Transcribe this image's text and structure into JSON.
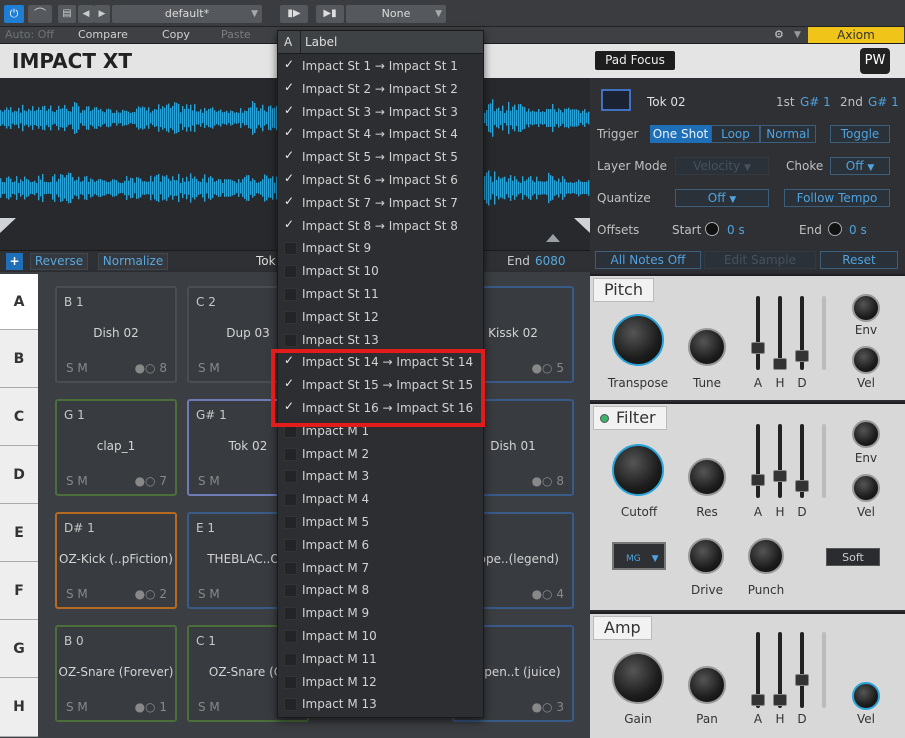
{
  "toolbar": {
    "preset": "default*",
    "routing": "None",
    "auto": "Auto: Off",
    "compare": "Compare",
    "copy": "Copy",
    "paste": "Paste",
    "device": "Axiom"
  },
  "header": {
    "logo": "IMPACT XT",
    "pad_focus": "Pad Focus"
  },
  "sample": {
    "reverse": "Reverse",
    "normalize": "Normalize",
    "name_partial": "Tok",
    "end_label": "End",
    "end_value": "6080"
  },
  "rows": [
    "A",
    "B",
    "C",
    "D",
    "E",
    "F",
    "G",
    "H"
  ],
  "pads": [
    {
      "note": "B 1",
      "name": "Dish 02",
      "count": "8",
      "color": "#4a4e54"
    },
    {
      "note": "C 2",
      "name": "Dup 03",
      "count": "",
      "color": "#4a4e54"
    },
    {
      "note": "",
      "name": "Kissk 02",
      "count": "5",
      "color": "#3a5a88"
    },
    {
      "note": "G 1",
      "name": "clap_1",
      "count": "7",
      "color": "#4b6e3b"
    },
    {
      "note": "G# 1",
      "name": "Tok 02",
      "count": "",
      "color": "#6e7bb6"
    },
    {
      "note": "",
      "name": "Dish 01",
      "count": "8",
      "color": "#3a5a88"
    },
    {
      "note": "D# 1",
      "name": "OZ-Kick (..pFiction)",
      "count": "2",
      "color": "#b76b22"
    },
    {
      "note": "E 1",
      "name": "THEBLAC..ON",
      "count": "",
      "color": "#3a5a88"
    },
    {
      "note": "",
      "name": "k-ope..(legend)",
      "count": "4",
      "color": "#3a5a88"
    },
    {
      "note": "B 0",
      "name": "OZ-Snare (Forever)",
      "count": "1",
      "color": "#4b6e3b"
    },
    {
      "note": "C 1",
      "name": "OZ-Snare (Cr",
      "count": "",
      "color": "#4b6e3b"
    },
    {
      "note": "",
      "name": "k-open..t (juice)",
      "count": "3",
      "color": "#3a5a88"
    }
  ],
  "pad_sm": "S  M",
  "right": {
    "pad_name": "Tok 02",
    "first": "1st",
    "first_val": "G# 1",
    "second": "2nd",
    "second_val": "G# 1",
    "trigger": "Trigger",
    "one_shot": "One Shot",
    "loop": "Loop",
    "normal": "Normal",
    "toggle": "Toggle",
    "layer_mode": "Layer Mode",
    "velocity": "Velocity",
    "choke": "Choke",
    "choke_val": "Off",
    "quantize": "Quantize",
    "quantize_val": "Off",
    "follow_tempo": "Follow Tempo",
    "offsets": "Offsets",
    "start": "Start",
    "start_val": "0 s",
    "end": "End",
    "end_val": "0 s",
    "all_notes_off": "All Notes Off",
    "edit_sample": "Edit Sample",
    "reset": "Reset"
  },
  "pitch": {
    "title": "Pitch",
    "transpose": "Transpose",
    "tune": "Tune",
    "a": "A",
    "h": "H",
    "d": "D",
    "env": "Env",
    "vel": "Vel"
  },
  "filter": {
    "title": "Filter",
    "cutoff": "Cutoff",
    "res": "Res",
    "a": "A",
    "h": "H",
    "d": "D",
    "env": "Env",
    "vel": "Vel",
    "drive": "Drive",
    "punch": "Punch",
    "soft": "Soft",
    "mode": "MG"
  },
  "amp": {
    "title": "Amp",
    "gain": "Gain",
    "pan": "Pan",
    "a": "A",
    "h": "H",
    "d": "D",
    "vel": "Vel"
  },
  "dropdown": {
    "col_a": "A",
    "col_label": "Label",
    "items": [
      {
        "label": "Impact St 1 → Impact St 1",
        "checked": true
      },
      {
        "label": "Impact St 2 → Impact St 2",
        "checked": true
      },
      {
        "label": "Impact St 3 → Impact St 3",
        "checked": true
      },
      {
        "label": "Impact St 4 → Impact St 4",
        "checked": true
      },
      {
        "label": "Impact St 5 → Impact St 5",
        "checked": true
      },
      {
        "label": "Impact St 6 → Impact St 6",
        "checked": true
      },
      {
        "label": "Impact St 7 → Impact St 7",
        "checked": true
      },
      {
        "label": "Impact St 8 → Impact St 8",
        "checked": true
      },
      {
        "label": "Impact St 9",
        "checked": false
      },
      {
        "label": "Impact St 10",
        "checked": false
      },
      {
        "label": "Impact St 11",
        "checked": false
      },
      {
        "label": "Impact St 12",
        "checked": false
      },
      {
        "label": "Impact St 13",
        "checked": false
      },
      {
        "label": "Impact St 14 → Impact St 14",
        "checked": true
      },
      {
        "label": "Impact St 15 → Impact St 15",
        "checked": true
      },
      {
        "label": "Impact St 16 → Impact St 16",
        "checked": true
      },
      {
        "label": "Impact M 1",
        "checked": false
      },
      {
        "label": "Impact M 2",
        "checked": false
      },
      {
        "label": "Impact M 3",
        "checked": false
      },
      {
        "label": "Impact M 4",
        "checked": false
      },
      {
        "label": "Impact M 5",
        "checked": false
      },
      {
        "label": "Impact M 6",
        "checked": false
      },
      {
        "label": "Impact M 7",
        "checked": false
      },
      {
        "label": "Impact M 8",
        "checked": false
      },
      {
        "label": "Impact M 9",
        "checked": false
      },
      {
        "label": "Impact M 10",
        "checked": false
      },
      {
        "label": "Impact M 11",
        "checked": false
      },
      {
        "label": "Impact M 12",
        "checked": false
      },
      {
        "label": "Impact M 13",
        "checked": false
      }
    ]
  }
}
